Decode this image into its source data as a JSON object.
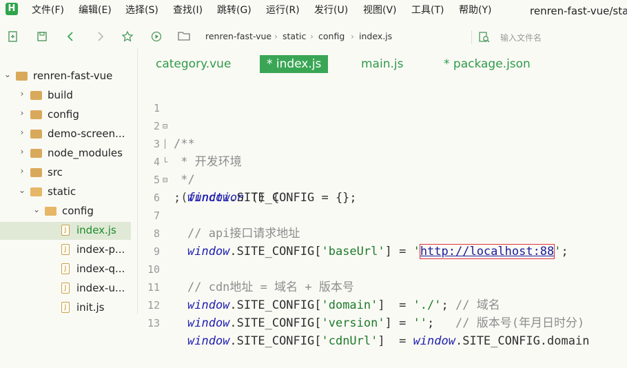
{
  "app": {
    "logo": "H",
    "window_title": "renren-fast-vue/stat"
  },
  "menu": [
    "文件(F)",
    "编辑(E)",
    "选择(S)",
    "查找(I)",
    "跳转(G)",
    "运行(R)",
    "发行(U)",
    "视图(V)",
    "工具(T)",
    "帮助(Y)"
  ],
  "toolbar": {
    "icons": [
      "new-file-icon",
      "save-icon",
      "back-icon",
      "forward-icon",
      "star-icon",
      "run-icon"
    ],
    "breadcrumb": [
      "renren-fast-vue",
      "static",
      "config",
      "index.js"
    ],
    "file_search_placeholder": "输入文件名"
  },
  "sidebar": {
    "root": "renren-fast-vue",
    "items": [
      {
        "label": "build"
      },
      {
        "label": "config"
      },
      {
        "label": "demo-screen..."
      },
      {
        "label": "node_modules"
      },
      {
        "label": "src"
      },
      {
        "label": "static"
      },
      {
        "label": "config"
      },
      {
        "label": "index.js"
      },
      {
        "label": "index-p..."
      },
      {
        "label": "index-q..."
      },
      {
        "label": "index-u..."
      },
      {
        "label": "init.js"
      }
    ]
  },
  "tabs": [
    "category.vue",
    "* index.js",
    "main.js",
    "* package.json"
  ],
  "editor": {
    "line_numbers": [
      "1",
      "2",
      "3",
      "4",
      "5",
      "6",
      "7",
      "8",
      "9",
      "10",
      "11",
      "12",
      "13"
    ],
    "lines": {
      "l1": "/**",
      "l2": " * 开发环境",
      "l3": " */",
      "l4a": ";(",
      "l4b": "function",
      "l4c": " () {",
      "l5a": "window",
      "l5b": ".SITE_CONFIG = {};",
      "l7": "// api接口请求地址",
      "l8a": "window",
      "l8b": ".SITE_CONFIG[",
      "l8c": "'baseUrl'",
      "l8d": "] = ",
      "l8e": "'",
      "l8f": "http://localhost:88",
      "l8g": "'",
      "l8h": ";",
      "l10": "// cdn地址 = 域名 + 版本号",
      "l11a": "window",
      "l11b": ".SITE_CONFIG[",
      "l11c": "'domain'",
      "l11d": "]  = ",
      "l11e": "'./'",
      "l11f": "; ",
      "l11g": "// 域名",
      "l12a": "window",
      "l12b": ".SITE_CONFIG[",
      "l12c": "'version'",
      "l12d": "] = ",
      "l12e": "''",
      "l12f": ";   ",
      "l12g": "// 版本号(年月日时分)",
      "l13a": "window",
      "l13b": ".SITE_CONFIG[",
      "l13c": "'cdnUrl'",
      "l13d": "]  = ",
      "l13e": "window",
      "l13f": ".SITE_CONFIG.domain"
    }
  }
}
